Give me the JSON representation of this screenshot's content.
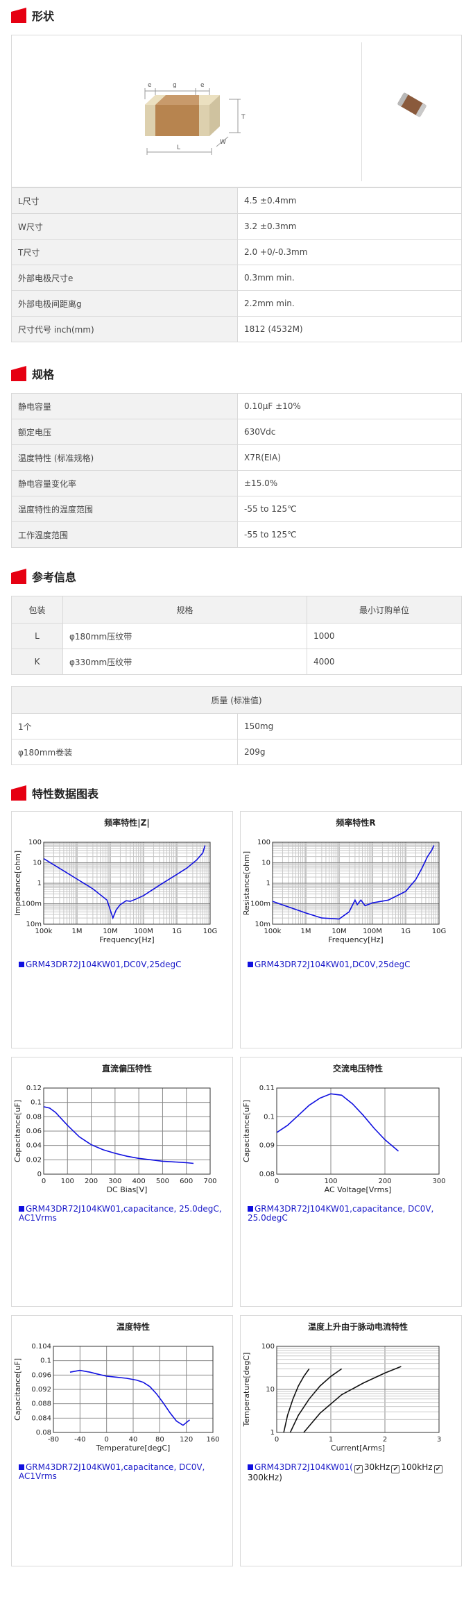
{
  "sections": {
    "shape_title": "形状",
    "spec_title": "规格",
    "ref_title": "参考信息",
    "chart_title": "特性数据图表"
  },
  "colors": {
    "accent": "#e60012",
    "curve": "#1010e0",
    "header_bg": "#f2f2f2"
  },
  "diagram": {
    "labels": [
      "e",
      "g",
      "e",
      "T",
      "W",
      "L"
    ]
  },
  "shape_rows": [
    {
      "k": "L尺寸",
      "v": "4.5 ±0.4mm"
    },
    {
      "k": "W尺寸",
      "v": "3.2 ±0.3mm"
    },
    {
      "k": "T尺寸",
      "v": "2.0 +0/-0.3mm"
    },
    {
      "k": "外部电极尺寸e",
      "v": "0.3mm min."
    },
    {
      "k": "外部电极间距离g",
      "v": "2.2mm min."
    },
    {
      "k": "尺寸代号 inch(mm)",
      "v": "1812 (4532M)"
    }
  ],
  "spec_rows": [
    {
      "k": "静电容量",
      "v": "0.10μF ±10%"
    },
    {
      "k": "额定电压",
      "v": "630Vdc"
    },
    {
      "k": "温度特性 (标准规格)",
      "v": "X7R(EIA)"
    },
    {
      "k": "静电容量变化率",
      "v": "±15.0%"
    },
    {
      "k": "温度特性的温度范围",
      "v": "-55 to 125℃"
    },
    {
      "k": "工作温度范围",
      "v": "-55 to 125℃"
    }
  ],
  "package": {
    "headers": [
      "包装",
      "规格",
      "最小订购单位"
    ],
    "rows": [
      {
        "code": "L",
        "spec": "φ180mm压纹带",
        "min": "1000"
      },
      {
        "code": "K",
        "spec": "φ330mm压纹带",
        "min": "4000"
      }
    ]
  },
  "mass": {
    "header": "质量 (标准值)",
    "rows": [
      {
        "k": "1个",
        "v": "150mg"
      },
      {
        "k": "φ180mm卷装",
        "v": "209g"
      }
    ]
  },
  "charts": {
    "c1": {
      "title": "频率特性|Z|",
      "ylabel": "Impedance[ohm]",
      "xlabel": "Frequency[Hz]",
      "legend": "GRM43DR72J104KW01,DC0V,25degC",
      "xticks": [
        "100k",
        "1M",
        "10M",
        "100M",
        "1G",
        "10G"
      ],
      "yticks": [
        "100",
        "10",
        "1",
        "100m",
        "10m"
      ]
    },
    "c2": {
      "title": "频率特性R",
      "ylabel": "Resistance[ohm]",
      "xlabel": "Frequency[Hz]",
      "legend": "GRM43DR72J104KW01,DC0V,25degC",
      "xticks": [
        "100k",
        "1M",
        "10M",
        "100M",
        "1G",
        "10G"
      ],
      "yticks": [
        "100",
        "10",
        "1",
        "100m",
        "10m"
      ]
    },
    "c3": {
      "title": "直流偏压特性",
      "ylabel": "Capacitance[uF]",
      "xlabel": "DC Bias[V]",
      "legend": "GRM43DR72J104KW01,capacitance, 25.0degC, AC1Vrms",
      "xticks": [
        "0",
        "100",
        "200",
        "300",
        "400",
        "500",
        "600",
        "700"
      ],
      "yticks": [
        "0.12",
        "0.1",
        "0.08",
        "0.06",
        "0.04",
        "0.02",
        "0"
      ]
    },
    "c4": {
      "title": "交流电压特性",
      "ylabel": "Capacitance[uF]",
      "xlabel": "AC Voltage[Vrms]",
      "legend": "GRM43DR72J104KW01,capacitance, DC0V, 25.0degC",
      "xticks": [
        "0",
        "100",
        "200",
        "300"
      ],
      "yticks": [
        "0.11",
        "0.1",
        "0.09",
        "0.08"
      ]
    },
    "c5": {
      "title": "温度特性",
      "ylabel": "Capacitance[uF]",
      "xlabel": "Temperature[degC]",
      "legend": "GRM43DR72J104KW01,capacitance, DC0V, AC1Vrms",
      "xticks": [
        "-80",
        "-40",
        "0",
        "40",
        "80",
        "120",
        "160"
      ],
      "yticks": [
        "0.104",
        "0.1",
        "0.096",
        "0.092",
        "0.088",
        "0.084",
        "0.08"
      ]
    },
    "c6": {
      "title": "温度上升由于脉动电流特性",
      "ylabel": "Temperature[degC]",
      "xlabel": "Current[Arms]",
      "legend_prefix": "GRM43DR72J104KW01(",
      "legend_items": [
        "30kHz",
        "100kHz",
        "300kHz"
      ],
      "legend_suffix": ")",
      "xticks": [
        "0",
        "1",
        "2",
        "3"
      ],
      "yticks": [
        "100",
        "10",
        "1"
      ]
    }
  },
  "chart_data": [
    {
      "type": "line",
      "title": "频率特性|Z|",
      "xlabel": "Frequency[Hz]",
      "ylabel": "Impedance[ohm]",
      "xscale": "log",
      "yscale": "log",
      "xlim": [
        100000,
        10000000000
      ],
      "ylim": [
        0.01,
        100
      ],
      "series": [
        {
          "name": "GRM43DR72J104KW01,DC0V,25degC",
          "x": [
            100000,
            300000,
            1000000,
            3000000,
            8000000,
            12000000,
            15000000,
            20000000,
            30000000,
            40000000,
            60000000,
            100000000,
            300000000,
            1000000000,
            2000000000,
            4000000000,
            6000000000,
            7000000000
          ],
          "y": [
            16,
            5.3,
            1.6,
            0.53,
            0.15,
            0.02,
            0.05,
            0.09,
            0.14,
            0.13,
            0.17,
            0.25,
            0.8,
            2.7,
            5.5,
            14,
            30,
            70
          ]
        }
      ]
    },
    {
      "type": "line",
      "title": "频率特性R",
      "xlabel": "Frequency[Hz]",
      "ylabel": "Resistance[ohm]",
      "xscale": "log",
      "yscale": "log",
      "xlim": [
        100000,
        10000000000
      ],
      "ylim": [
        0.01,
        100
      ],
      "series": [
        {
          "name": "GRM43DR72J104KW01,DC0V,25degC",
          "x": [
            100000,
            300000,
            1000000,
            3000000,
            10000000,
            20000000,
            30000000,
            35000000,
            45000000,
            60000000,
            100000000,
            300000000,
            1000000000,
            2000000000,
            3000000000,
            4500000000,
            6000000000,
            7000000000
          ],
          "y": [
            0.13,
            0.07,
            0.035,
            0.02,
            0.018,
            0.04,
            0.15,
            0.09,
            0.15,
            0.08,
            0.11,
            0.15,
            0.4,
            1.5,
            5,
            20,
            40,
            70
          ]
        }
      ]
    },
    {
      "type": "line",
      "title": "直流偏压特性",
      "xlabel": "DC Bias[V]",
      "ylabel": "Capacitance[uF]",
      "xlim": [
        0,
        700
      ],
      "ylim": [
        0,
        0.12
      ],
      "series": [
        {
          "name": "GRM43DR72J104KW01,capacitance, 25.0degC, AC1Vrms",
          "x": [
            0,
            25,
            50,
            75,
            100,
            150,
            200,
            250,
            300,
            350,
            400,
            450,
            500,
            550,
            600,
            630
          ],
          "y": [
            0.094,
            0.092,
            0.086,
            0.077,
            0.068,
            0.052,
            0.041,
            0.034,
            0.029,
            0.025,
            0.022,
            0.02,
            0.018,
            0.017,
            0.016,
            0.015
          ]
        }
      ]
    },
    {
      "type": "line",
      "title": "交流电压特性",
      "xlabel": "AC Voltage[Vrms]",
      "ylabel": "Capacitance[uF]",
      "xlim": [
        0,
        300
      ],
      "ylim": [
        0.08,
        0.11
      ],
      "series": [
        {
          "name": "GRM43DR72J104KW01,capacitance, DC0V, 25.0degC",
          "x": [
            0,
            20,
            40,
            60,
            80,
            100,
            120,
            140,
            160,
            180,
            200,
            225
          ],
          "y": [
            0.0945,
            0.097,
            0.1005,
            0.104,
            0.1065,
            0.108,
            0.1075,
            0.1045,
            0.1005,
            0.096,
            0.092,
            0.088
          ]
        }
      ]
    },
    {
      "type": "line",
      "title": "温度特性",
      "xlabel": "Temperature[degC]",
      "ylabel": "Capacitance[uF]",
      "xlim": [
        -80,
        160
      ],
      "ylim": [
        0.08,
        0.104
      ],
      "series": [
        {
          "name": "GRM43DR72J104KW01,capacitance, DC0V, AC1Vrms",
          "x": [
            -55,
            -40,
            -25,
            -10,
            0,
            15,
            30,
            45,
            55,
            65,
            75,
            85,
            95,
            105,
            115,
            125
          ],
          "y": [
            0.0968,
            0.0973,
            0.0968,
            0.0961,
            0.0957,
            0.0954,
            0.0951,
            0.0946,
            0.094,
            0.0928,
            0.0908,
            0.0883,
            0.0856,
            0.0832,
            0.082,
            0.0835
          ]
        }
      ]
    },
    {
      "type": "line",
      "title": "温度上升由于脉动电流特性",
      "xlabel": "Current[Arms]",
      "ylabel": "Temperature[degC]",
      "xlim": [
        0,
        3
      ],
      "yscale": "log",
      "ylim": [
        1,
        100
      ],
      "series": [
        {
          "name": "30kHz",
          "x": [
            0.13,
            0.2,
            0.3,
            0.4,
            0.5,
            0.6
          ],
          "y": [
            1,
            2.5,
            6,
            12,
            20,
            30
          ]
        },
        {
          "name": "100kHz",
          "x": [
            0.25,
            0.4,
            0.6,
            0.8,
            1.0,
            1.2
          ],
          "y": [
            1,
            2.5,
            6,
            12,
            20,
            30
          ]
        },
        {
          "name": "300kHz",
          "x": [
            0.5,
            0.8,
            1.2,
            1.6,
            2.0,
            2.3
          ],
          "y": [
            1,
            2.8,
            7.5,
            14,
            24,
            34
          ]
        }
      ]
    }
  ]
}
